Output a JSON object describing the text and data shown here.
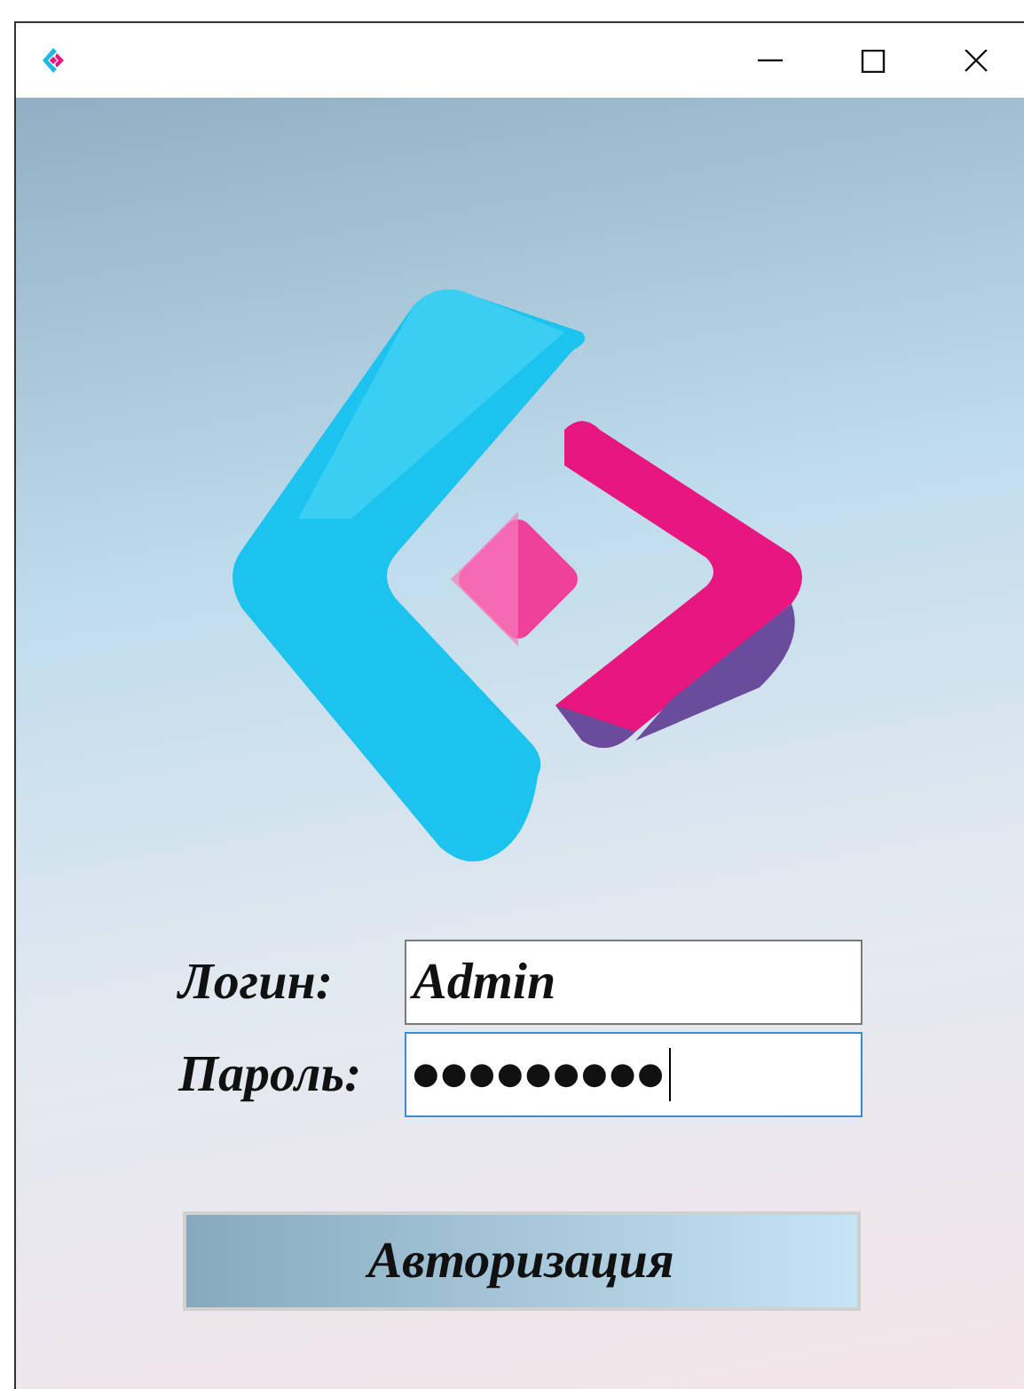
{
  "window": {
    "controls": [
      {
        "kind": "minimize"
      },
      {
        "kind": "maximize"
      },
      {
        "kind": "close"
      }
    ]
  },
  "form": {
    "fields": [
      {
        "label": "Логин:",
        "value": "Admin",
        "focused": false
      },
      {
        "label": "Пароль:",
        "value": "●●●●●●●●●",
        "focused": true
      }
    ],
    "submit": "Авторизация"
  }
}
